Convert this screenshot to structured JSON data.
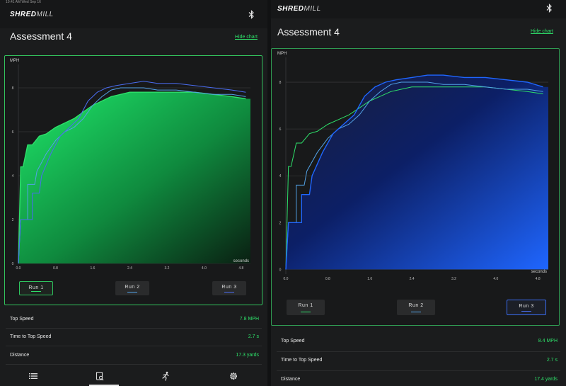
{
  "colors": {
    "green": "#2ee06a",
    "blue": "#1f66ff",
    "run2": "#52a2e6",
    "run3": "#4a6cf0"
  },
  "left": {
    "status": "10:41 AM   Wed Sep 16",
    "logo_main": "SHRED",
    "logo_sub": "MILL",
    "title": "Assessment 4",
    "hide_chart": "Hide chart",
    "runs": [
      "Run 1",
      "Run 2",
      "Run 3"
    ],
    "stats": [
      {
        "label": "Top Speed",
        "value": "7.8 MPH"
      },
      {
        "label": "Time to Top Speed",
        "value": "2.7 s"
      },
      {
        "label": "Distance",
        "value": "17.3 yards"
      }
    ],
    "nav": [
      "list-icon",
      "report-icon",
      "runner-icon",
      "gear-icon"
    ]
  },
  "right": {
    "logo_main": "SHRED",
    "logo_sub": "MILL",
    "title": "Assessment 4",
    "hide_chart": "Hide chart",
    "runs": [
      "Run 1",
      "Run 2",
      "Run 3"
    ],
    "stats": [
      {
        "label": "Top Speed",
        "value": "8.4 MPH"
      },
      {
        "label": "Time to Top Speed",
        "value": "2.7 s"
      },
      {
        "label": "Distance",
        "value": "17.4 yards"
      }
    ]
  },
  "chart_data": [
    {
      "type": "area",
      "ylabel": "MPH",
      "xlabel": "seconds",
      "xlim": [
        0,
        5.0
      ],
      "ylim": [
        0,
        9
      ],
      "xticks": [
        "0.0",
        "0.8",
        "1.6",
        "2.4",
        "3.2",
        "4.0",
        "4.8"
      ],
      "yticks": [
        "0",
        "2",
        "4",
        "6",
        "8"
      ],
      "highlighted": "Run 1",
      "series": [
        {
          "name": "Run 1",
          "x": [
            0.0,
            0.05,
            0.1,
            0.2,
            0.3,
            0.45,
            0.6,
            0.8,
            1.0,
            1.2,
            1.4,
            1.6,
            1.8,
            2.0,
            2.2,
            2.4,
            2.7,
            3.0,
            3.4,
            3.8,
            4.2,
            4.6,
            4.9
          ],
          "y": [
            0,
            4.4,
            4.4,
            5.4,
            5.4,
            5.8,
            5.9,
            6.2,
            6.4,
            6.6,
            6.9,
            7.2,
            7.4,
            7.6,
            7.7,
            7.8,
            7.8,
            7.8,
            7.8,
            7.8,
            7.7,
            7.6,
            7.5
          ]
        },
        {
          "name": "Run 2",
          "x": [
            0.0,
            0.05,
            0.2,
            0.2,
            0.35,
            0.4,
            0.6,
            0.8,
            1.0,
            1.2,
            1.4,
            1.6,
            1.8,
            2.0,
            2.2,
            2.4,
            2.7,
            3.0,
            3.4,
            3.8,
            4.2,
            4.6,
            4.9
          ],
          "y": [
            0,
            2.0,
            2.0,
            3.6,
            3.6,
            4.2,
            5.0,
            5.6,
            6.0,
            6.2,
            6.6,
            7.2,
            7.6,
            7.9,
            8.0,
            8.0,
            8.0,
            7.9,
            7.9,
            7.8,
            7.7,
            7.7,
            7.6
          ]
        },
        {
          "name": "Run 3",
          "x": [
            0.0,
            0.05,
            0.3,
            0.3,
            0.45,
            0.5,
            0.7,
            0.9,
            1.1,
            1.3,
            1.5,
            1.7,
            1.9,
            2.1,
            2.4,
            2.7,
            3.0,
            3.4,
            3.8,
            4.2,
            4.6,
            4.9
          ],
          "y": [
            0,
            2.0,
            2.0,
            3.2,
            3.2,
            4.0,
            5.0,
            5.8,
            6.2,
            6.6,
            7.4,
            7.8,
            8.0,
            8.1,
            8.2,
            8.3,
            8.2,
            8.2,
            8.1,
            8.0,
            7.9,
            7.8
          ]
        }
      ]
    },
    {
      "type": "area",
      "ylabel": "MPH",
      "xlabel": "seconds",
      "xlim": [
        0,
        5.0
      ],
      "ylim": [
        -0.2,
        9
      ],
      "xticks": [
        "0.0",
        "0.8",
        "1.6",
        "2.4",
        "3.2",
        "4.0",
        "4.8"
      ],
      "yticks": [
        "0",
        "2",
        "4",
        "6",
        "8"
      ],
      "highlighted": "Run 3",
      "series": [
        {
          "name": "Run 1",
          "x": [
            0.0,
            0.05,
            0.1,
            0.2,
            0.3,
            0.45,
            0.6,
            0.8,
            1.0,
            1.2,
            1.4,
            1.6,
            1.8,
            2.0,
            2.2,
            2.4,
            2.7,
            3.0,
            3.4,
            3.8,
            4.2,
            4.6,
            4.9
          ],
          "y": [
            0,
            4.4,
            4.4,
            5.4,
            5.4,
            5.8,
            5.9,
            6.2,
            6.4,
            6.6,
            6.9,
            7.2,
            7.4,
            7.6,
            7.7,
            7.8,
            7.8,
            7.8,
            7.8,
            7.8,
            7.7,
            7.6,
            7.5
          ]
        },
        {
          "name": "Run 2",
          "x": [
            0.0,
            0.05,
            0.2,
            0.2,
            0.35,
            0.4,
            0.6,
            0.8,
            1.0,
            1.2,
            1.4,
            1.6,
            1.8,
            2.0,
            2.2,
            2.4,
            2.7,
            3.0,
            3.4,
            3.8,
            4.2,
            4.6,
            4.9
          ],
          "y": [
            0,
            2.0,
            2.0,
            3.6,
            3.6,
            4.2,
            5.0,
            5.6,
            6.0,
            6.2,
            6.6,
            7.2,
            7.6,
            7.9,
            8.0,
            8.0,
            8.0,
            7.9,
            7.9,
            7.8,
            7.7,
            7.7,
            7.6
          ]
        },
        {
          "name": "Run 3",
          "x": [
            0.0,
            0.05,
            0.3,
            0.3,
            0.45,
            0.5,
            0.7,
            0.9,
            1.1,
            1.3,
            1.5,
            1.7,
            1.9,
            2.1,
            2.4,
            2.7,
            3.0,
            3.4,
            3.8,
            4.2,
            4.6,
            4.9
          ],
          "y": [
            0,
            2.0,
            2.0,
            3.2,
            3.2,
            4.0,
            5.0,
            5.8,
            6.2,
            6.6,
            7.4,
            7.8,
            8.0,
            8.1,
            8.2,
            8.3,
            8.3,
            8.2,
            8.2,
            8.1,
            8.0,
            7.8
          ]
        }
      ]
    }
  ]
}
